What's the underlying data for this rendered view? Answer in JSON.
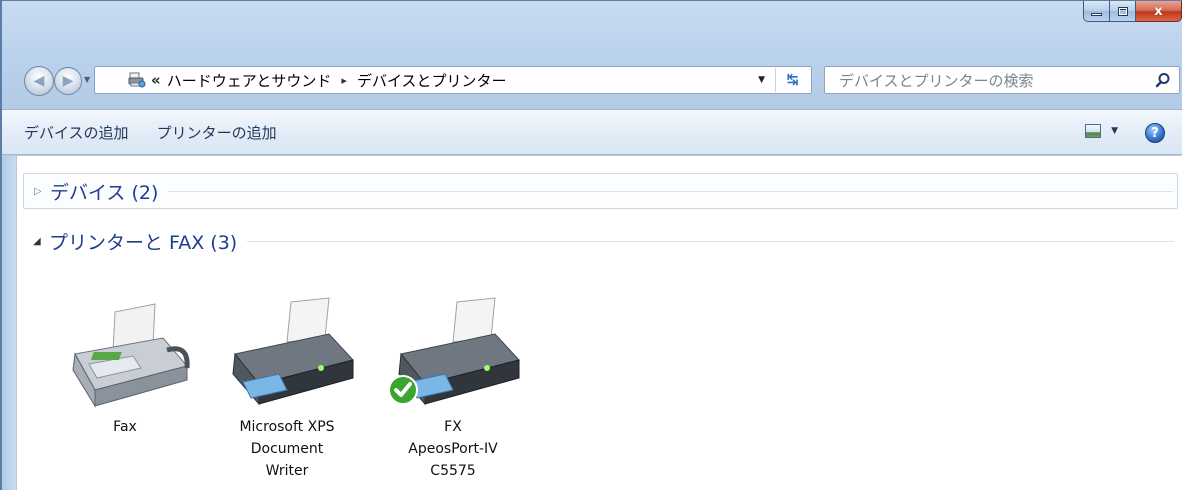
{
  "window": {
    "caption_close": "x"
  },
  "address": {
    "overflow_chevron": "«",
    "segments": [
      "ハードウェアとサウンド",
      "デバイスとプリンター"
    ],
    "separator": "▸"
  },
  "search": {
    "placeholder": "デバイスとプリンターの検索"
  },
  "toolbar": {
    "add_device": "デバイスの追加",
    "add_printer": "プリンターの追加",
    "help": "?"
  },
  "groups": {
    "devices": {
      "title": "デバイス (2)",
      "expanded": false
    },
    "printers": {
      "title": "プリンターと FAX (3)",
      "expanded": true
    }
  },
  "printers": [
    {
      "label_lines": [
        "Fax"
      ],
      "icon": "fax-icon",
      "is_default": false
    },
    {
      "label_lines": [
        "Microsoft XPS",
        "Document",
        "Writer"
      ],
      "icon": "printer-icon",
      "is_default": false
    },
    {
      "label_lines": [
        "FX",
        "ApeosPort-IV",
        "C5575"
      ],
      "icon": "printer-icon",
      "is_default": true
    }
  ],
  "colors": {
    "group_title": "#1e3d8f",
    "command_text": "#1e395b",
    "default_badge": "#3aa52f"
  }
}
